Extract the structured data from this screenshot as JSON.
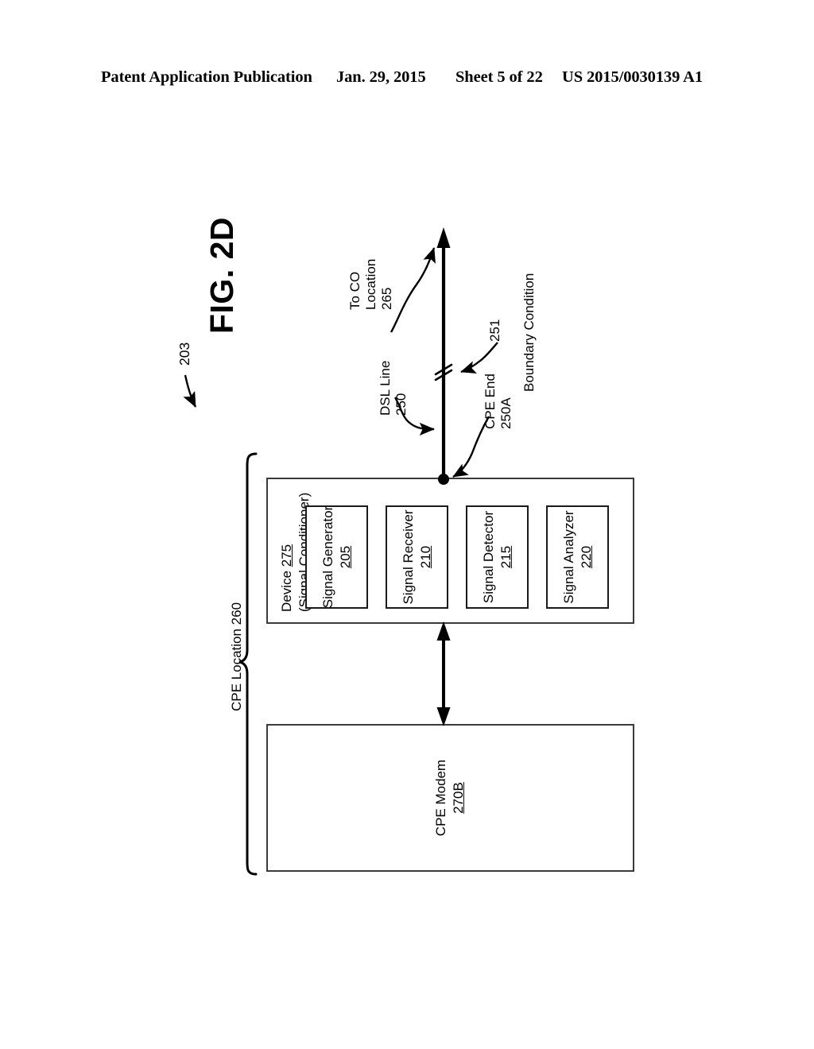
{
  "header": {
    "publication": "Patent Application Publication",
    "date": "Jan. 29, 2015",
    "sheet": "Sheet 5 of 22",
    "patent_number": "US 2015/0030139 A1"
  },
  "figure": {
    "title": "FIG. 2D",
    "figure_ref": "203",
    "callouts": {
      "to_co_location": {
        "line1": "To CO",
        "line2": "Location",
        "ref": "265"
      },
      "dsl_line": {
        "line1": "DSL Line",
        "ref": "250"
      },
      "cpe_end": {
        "line1": "CPE End",
        "ref": "250A"
      },
      "boundary_condition": {
        "ref": "251",
        "label": "Boundary Condition"
      },
      "cpe_location": {
        "label": "CPE Location 260"
      }
    },
    "device_box": {
      "title_line1": "Device",
      "title_ref": "275",
      "title_line2": "(Signal Conditioner)",
      "components": [
        {
          "name": "Signal Generator",
          "ref": "205"
        },
        {
          "name": "Signal Receiver",
          "ref": "210"
        },
        {
          "name": "Signal Detector",
          "ref": "215"
        },
        {
          "name": "Signal Analyzer",
          "ref": "220"
        }
      ]
    },
    "modem_box": {
      "name": "CPE Modem",
      "ref": "270B"
    },
    "colors": {
      "ink": "#000000",
      "box_stroke": "#3a3a3a",
      "page_background": "#ffffff"
    }
  }
}
